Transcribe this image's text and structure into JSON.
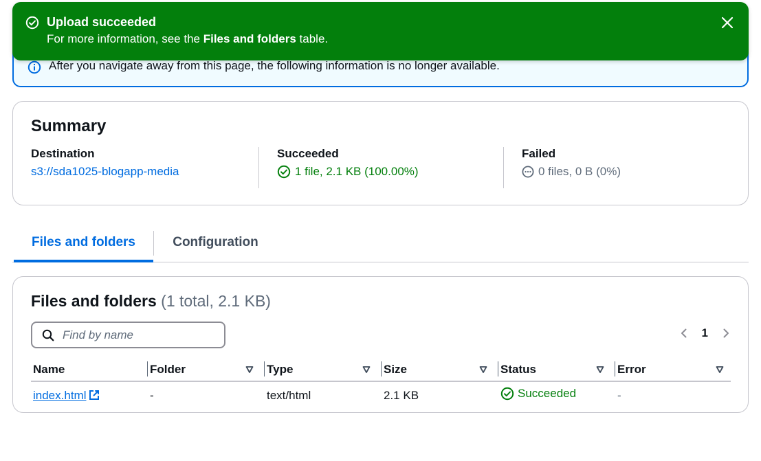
{
  "flash": {
    "title": "Upload succeeded",
    "message_prefix": "For more information, see the ",
    "message_bold": "Files and folders",
    "message_suffix": " table."
  },
  "info_alert": {
    "text": "After you navigate away from this page, the following information is no longer available."
  },
  "summary": {
    "title": "Summary",
    "destination_label": "Destination",
    "destination_value": "s3://sda1025-blogapp-media",
    "succeeded_label": "Succeeded",
    "succeeded_value": "1 file, 2.1 KB (100.00%)",
    "failed_label": "Failed",
    "failed_value": "0 files, 0 B (0%)"
  },
  "tabs": [
    {
      "label": "Files and folders",
      "active": true
    },
    {
      "label": "Configuration",
      "active": false
    }
  ],
  "files": {
    "title": "Files and folders",
    "count": "(1 total, 2.1 KB)",
    "search_placeholder": "Find by name",
    "page": "1",
    "columns": [
      "Name",
      "Folder",
      "Type",
      "Size",
      "Status",
      "Error"
    ],
    "rows": [
      {
        "name": "index.html",
        "folder": "-",
        "type": "text/html",
        "size": "2.1 KB",
        "status": "Succeeded",
        "error": "-"
      }
    ]
  },
  "colors": {
    "success": "#037f0c",
    "link": "#006ce0",
    "info_border": "#006ce0"
  }
}
